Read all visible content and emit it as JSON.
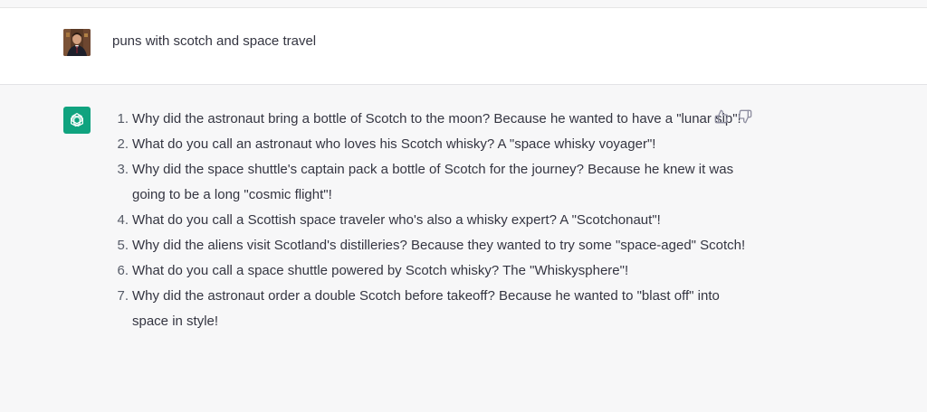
{
  "user_message": {
    "text": "puns with scotch and space travel"
  },
  "assistant_message": {
    "items": [
      {
        "num": "1.",
        "text": "Why did the astronaut bring a bottle of Scotch to the moon? Because he wanted to have a \"lunar sip\"!"
      },
      {
        "num": "2.",
        "text": "What do you call an astronaut who loves his Scotch whisky? A \"space whisky voyager\"!"
      },
      {
        "num": "3.",
        "text": "Why did the space shuttle's captain pack a bottle of Scotch for the journey? Because he knew it was going to be a long \"cosmic flight\"!"
      },
      {
        "num": "4.",
        "text": "What do you call a Scottish space traveler who's also a whisky expert? A \"Scotchonaut\"!"
      },
      {
        "num": "5.",
        "text": "Why did the aliens visit Scotland's distilleries? Because they wanted to try some \"space-aged\" Scotch!"
      },
      {
        "num": "6.",
        "text": "What do you call a space shuttle powered by Scotch whisky? The \"Whiskysphere\"!"
      },
      {
        "num": "7.",
        "text": "Why did the astronaut order a double Scotch before takeoff? Because he wanted to \"blast off\" into space in style!"
      }
    ]
  },
  "icons": {
    "user_avatar": "user-avatar-photo",
    "assistant_avatar": "openai-logo-icon",
    "thumbs_up": "thumbs-up-icon",
    "thumbs_down": "thumbs-down-icon"
  },
  "colors": {
    "assistant_logo_bg": "#10a37f",
    "assistant_row_bg": "#f7f7f8",
    "user_row_bg": "#ffffff",
    "text": "#343541"
  }
}
